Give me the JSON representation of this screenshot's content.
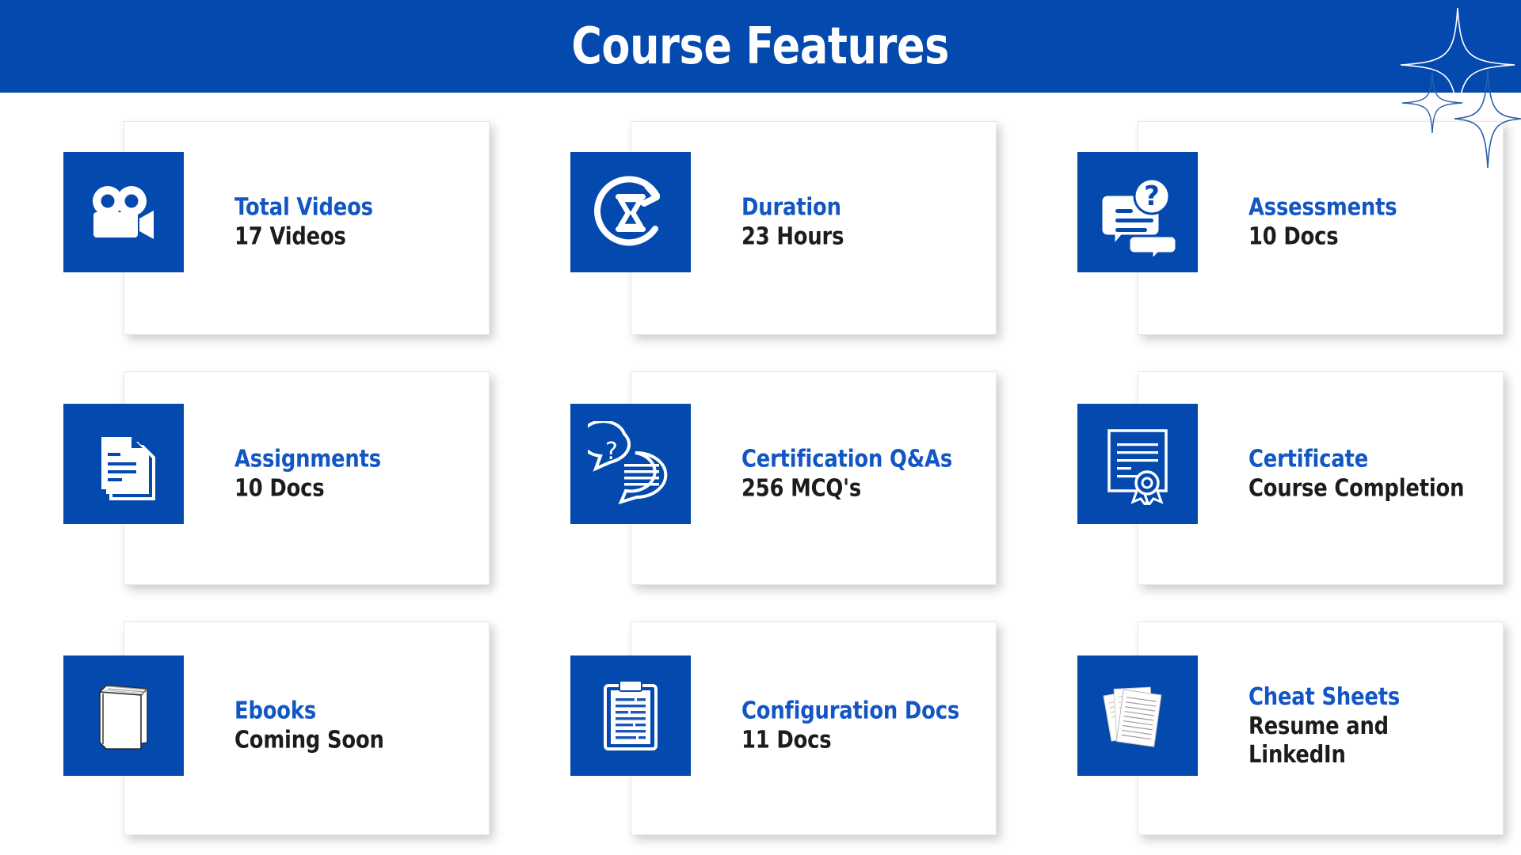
{
  "header": {
    "title": "Course Features",
    "background_color": "#0449ad",
    "title_color": "#ffffff",
    "decoration": "four-pointed-sparkle"
  },
  "theme": {
    "brand_blue": "#0449ad",
    "title_blue": "#1256c4",
    "value_black": "#1c1c1c",
    "card_background": "#ffffff",
    "page_background": "#ffffff"
  },
  "cards": [
    {
      "icon": "video-camera-icon",
      "title": "Total Videos",
      "value": "17 Videos"
    },
    {
      "icon": "hourglass-duration-icon",
      "title": "Duration",
      "value": "23 Hours"
    },
    {
      "icon": "assessment-question-bubble-icon",
      "title": "Assessments",
      "value": "10 Docs"
    },
    {
      "icon": "stacked-documents-icon",
      "title": "Assignments",
      "value": "10 Docs"
    },
    {
      "icon": "chat-bubbles-qa-icon",
      "title": "Certification Q&As",
      "value": "256 MCQ's"
    },
    {
      "icon": "certificate-ribbon-icon",
      "title": "Certificate",
      "value": "Course Completion"
    },
    {
      "icon": "book-icon",
      "title": "Ebooks",
      "value": "Coming Soon"
    },
    {
      "icon": "clipboard-docs-icon",
      "title": "Configuration Docs",
      "value": "11 Docs"
    },
    {
      "icon": "scattered-papers-icon",
      "title": "Cheat Sheets",
      "value": "Resume and\nLinkedIn"
    }
  ]
}
